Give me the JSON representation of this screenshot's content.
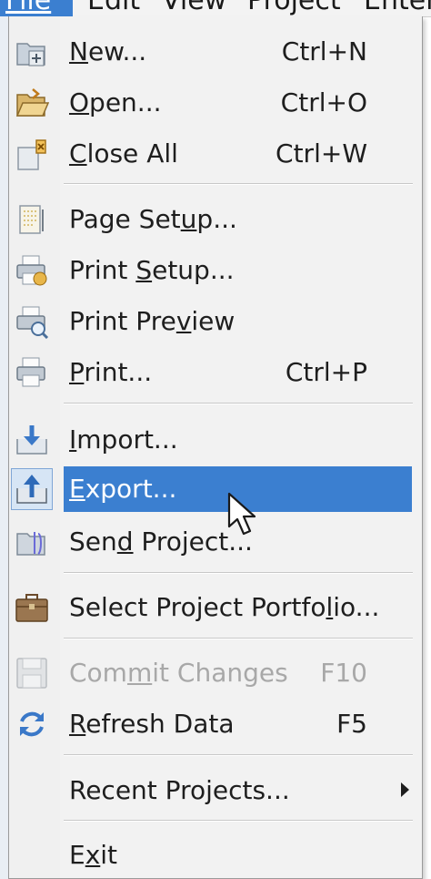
{
  "menubar": {
    "items": [
      "File",
      "Edit",
      "View",
      "Project",
      "Enter"
    ]
  },
  "menu": {
    "items": [
      {
        "id": "new",
        "label_pre": "",
        "label_key": "N",
        "label_post": "ew...",
        "shortcut": "Ctrl+N",
        "icon": "new-project-icon"
      },
      {
        "id": "open",
        "label_pre": "",
        "label_key": "O",
        "label_post": "pen...",
        "shortcut": "Ctrl+O",
        "icon": "open-folder-icon"
      },
      {
        "id": "close-all",
        "label_pre": "",
        "label_key": "C",
        "label_post": "lose All",
        "shortcut": "Ctrl+W",
        "icon": "close-document-icon"
      },
      {
        "id": "page-setup",
        "label_pre": "Page Set",
        "label_key": "u",
        "label_post": "p...",
        "shortcut": "",
        "icon": "page-setup-icon"
      },
      {
        "id": "print-setup",
        "label_pre": "Print ",
        "label_key": "S",
        "label_post": "etup...",
        "shortcut": "",
        "icon": "print-setup-icon"
      },
      {
        "id": "print-preview",
        "label_pre": "Print Pre",
        "label_key": "v",
        "label_post": "iew",
        "shortcut": "",
        "icon": "print-preview-icon"
      },
      {
        "id": "print",
        "label_pre": "",
        "label_key": "P",
        "label_post": "rint...",
        "shortcut": "Ctrl+P",
        "icon": "printer-icon"
      },
      {
        "id": "import",
        "label_pre": "",
        "label_key": "I",
        "label_post": "mport...",
        "shortcut": "",
        "icon": "import-icon"
      },
      {
        "id": "export",
        "label_pre": "",
        "label_key": "E",
        "label_post": "xport...",
        "shortcut": "",
        "icon": "export-icon"
      },
      {
        "id": "send-project",
        "label_pre": "Sen",
        "label_key": "d",
        "label_post": " Project...",
        "shortcut": "",
        "icon": "send-project-icon"
      },
      {
        "id": "select-portfolio",
        "label_pre": "Select Project Portfo",
        "label_key": "l",
        "label_post": "io...",
        "shortcut": "",
        "icon": "briefcase-icon"
      },
      {
        "id": "commit-changes",
        "label_pre": "Com",
        "label_key": "m",
        "label_post": "it Changes",
        "shortcut": "F10",
        "icon": "save-disk-icon"
      },
      {
        "id": "refresh-data",
        "label_pre": "",
        "label_key": "R",
        "label_post": "efresh Data",
        "shortcut": "F5",
        "icon": "refresh-icon"
      },
      {
        "id": "recent-projects",
        "label_pre": "Recent Projects...",
        "label_key": "",
        "label_post": "",
        "shortcut": "",
        "icon": ""
      },
      {
        "id": "exit",
        "label_pre": "E",
        "label_key": "x",
        "label_post": "it",
        "shortcut": "",
        "icon": ""
      }
    ]
  },
  "colors": {
    "highlight": "#3b7fd0",
    "menu_bg": "#f2f2f2",
    "disabled_text": "#a8a8a8"
  }
}
